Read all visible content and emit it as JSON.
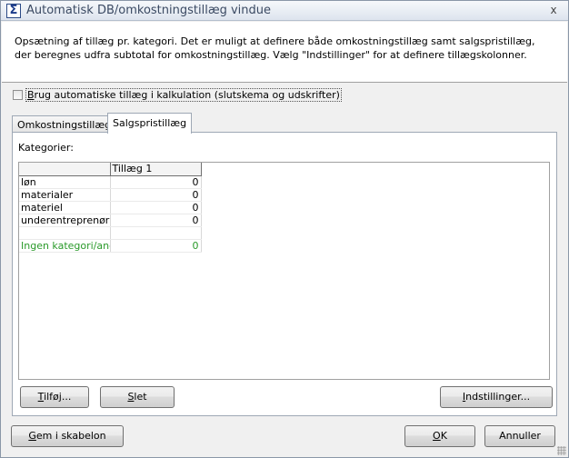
{
  "window": {
    "title": "Automatisk DB/omkostningstillæg vindue",
    "close_symbol": "x",
    "app_icon_glyph": "Σ",
    "app_icon": "sigma-icon"
  },
  "info": {
    "text": "Opsætning af tillæg pr. kategori. Det er muligt at definere både omkostningstillæg samt salgspristillæg, der beregnes udfra subtotal for omkostningstillæg. Vælg \"Indstillinger\" for at definere tillægskolonner."
  },
  "auto_checkbox": {
    "label_mnemonic": "B",
    "label_rest": "rug automatiske tillæg i kalkulation (slutskema og udskrifter)",
    "checked": false
  },
  "tabs": [
    {
      "label": "Omkostningstillæg",
      "active": false
    },
    {
      "label": "Salgspristillæg",
      "active": true
    }
  ],
  "panel": {
    "categories_label": "Kategorier:"
  },
  "grid": {
    "columns": [
      "",
      "Tillæg 1"
    ],
    "rows": [
      {
        "name": "løn",
        "value": "0"
      },
      {
        "name": "materialer",
        "value": "0"
      },
      {
        "name": "materiel",
        "value": "0"
      },
      {
        "name": "underentreprenør",
        "value": "0"
      },
      {
        "name": "",
        "value": ""
      },
      {
        "name": "Ingen kategori/anc",
        "value": "0"
      }
    ],
    "highlight_color": "#2a9a2a"
  },
  "buttons": {
    "add": {
      "mnemonic": "T",
      "rest": "ilføj..."
    },
    "delete": {
      "mnemonic": "S",
      "rest": "let"
    },
    "settings": {
      "mnemonic": "I",
      "rest": "ndstillinger..."
    },
    "save_template": {
      "mnemonic": "G",
      "rest": "em i skabelon"
    },
    "ok": {
      "mnemonic": "O",
      "rest": "K"
    },
    "cancel": {
      "label": "Annuller"
    }
  }
}
